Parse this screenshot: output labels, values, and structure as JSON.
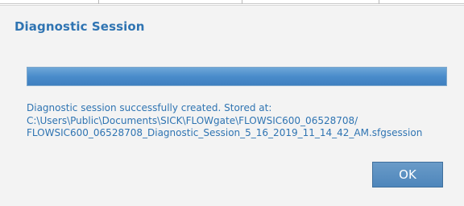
{
  "dialog": {
    "title": "Diagnostic Session",
    "progress": 1.0,
    "message_line1": "Diagnostic session successfully created. Stored at:",
    "message_line2": "C:\\Users\\Public\\Documents\\SICK\\FLOWgate\\FLOWSIC600_06528708/",
    "message_line3": "FLOWSIC600_06528708_Diagnostic_Session_5_16_2019_11_14_42_AM.sfgsession",
    "ok_label": "OK"
  },
  "colors": {
    "title_text": "#2f74b2",
    "message_text": "#2f74b2",
    "progress_fill": "#4a8ccb",
    "ok_button_bg": "#5a90c2",
    "dialog_bg": "#f3f3f3"
  }
}
